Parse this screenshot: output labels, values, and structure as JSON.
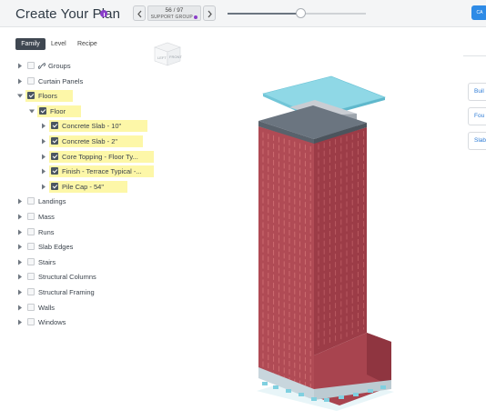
{
  "header": {
    "title": "Create Your Plan",
    "pager": {
      "count": "56 / 97",
      "label": "SUPPORT GROUP"
    },
    "slider_value_percent": 53,
    "help_badge": "CA"
  },
  "tabs": [
    {
      "label": "Family",
      "active": true
    },
    {
      "label": "Level",
      "active": false
    },
    {
      "label": "Recipe",
      "active": false
    }
  ],
  "tree": [
    {
      "label": "Groups",
      "checked": false,
      "expanded": false,
      "icon": "link-icon"
    },
    {
      "label": "Curtain Panels",
      "checked": false,
      "expanded": false
    },
    {
      "label": "Floors",
      "checked": true,
      "expanded": true,
      "highlighted": true
    },
    {
      "label": "Floor",
      "checked": true,
      "expanded": true,
      "highlighted": true
    },
    {
      "label": "Concrete Slab - 10\"",
      "checked": true,
      "expanded": false,
      "highlighted": true
    },
    {
      "label": "Concrete Slab - 2\"",
      "checked": true,
      "expanded": false,
      "highlighted": true
    },
    {
      "label": "Core Topping - Floor Ty...",
      "checked": true,
      "expanded": false,
      "highlighted": true
    },
    {
      "label": "Finish - Terrace Typical -...",
      "checked": true,
      "expanded": false,
      "highlighted": true
    },
    {
      "label": "Pile Cap - 54\"",
      "checked": true,
      "expanded": false,
      "highlighted": true
    },
    {
      "label": "Landings",
      "checked": false,
      "expanded": false
    },
    {
      "label": "Mass",
      "checked": false,
      "expanded": false
    },
    {
      "label": "Runs",
      "checked": false,
      "expanded": false
    },
    {
      "label": "Slab Edges",
      "checked": false,
      "expanded": false
    },
    {
      "label": "Stairs",
      "checked": false,
      "expanded": false
    },
    {
      "label": "Structural Columns",
      "checked": false,
      "expanded": false
    },
    {
      "label": "Structural Framing",
      "checked": false,
      "expanded": false
    },
    {
      "label": "Walls",
      "checked": false,
      "expanded": false
    },
    {
      "label": "Windows",
      "checked": false,
      "expanded": false
    }
  ],
  "side_panel": [
    {
      "label": "Buil"
    },
    {
      "label": "Fou"
    },
    {
      "label": "Slab"
    }
  ],
  "view_cube": {
    "left_face": "LEFT",
    "front_face": "FRONT"
  },
  "colors": {
    "accent": "#8a3ec9",
    "highlight": "#fdf7a8",
    "facade": "#a9454e",
    "roof": "#8fd8e6",
    "link": "#2e7cd6"
  }
}
